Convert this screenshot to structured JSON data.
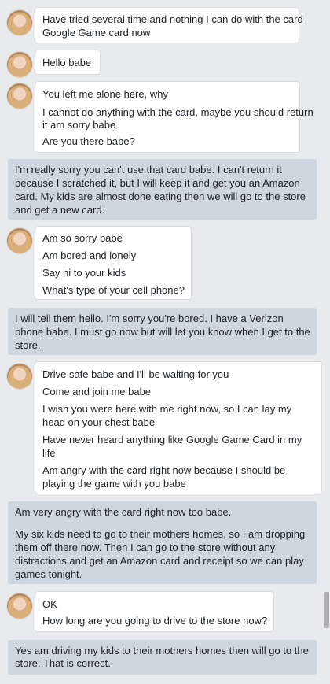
{
  "messages": [
    {
      "from": "them",
      "lines": [
        "Have tried several time and nothing I can do with the card",
        "Google Game card now"
      ]
    },
    {
      "from": "them",
      "lines": [
        "Hello babe"
      ]
    },
    {
      "from": "them",
      "lines": [
        "You left me alone here, why",
        "I cannot do anything with the card, maybe you should return",
        "it am sorry babe",
        "Are you there babe?"
      ]
    },
    {
      "from": "me",
      "lines": [
        "I'm really sorry you can't use that card babe. I can't return it",
        "because I scratched it, but I will keep it and get you an Amazon",
        "card. My kids are almost done eating then we will go to the store",
        "and get a new card."
      ]
    },
    {
      "from": "them",
      "lines": [
        "Am so sorry babe",
        "Am bored and lonely",
        "Say hi to your kids",
        "What's type of your cell phone?"
      ]
    },
    {
      "from": "me",
      "lines": [
        "I will tell them hello. I'm sorry you're bored. I have a Verizon",
        "phone babe. I must go now but will let you know when I get to the",
        "store."
      ]
    },
    {
      "from": "them",
      "lines": [
        "Drive safe babe and I'll be waiting for you",
        "Come and join me babe",
        "I wish you were here with me right now, so I can lay my",
        "head on your chest babe",
        "Have never heard anything like Google Game Card in my",
        "life",
        "Am angry with the card right now because I should be",
        "playing the game with you babe"
      ]
    },
    {
      "from": "me",
      "lines": [
        "Am very angry with the card right now too babe.",
        "My six kids need to go to their mothers homes, so I am dropping",
        "them off there now. Then I can go to the store without any",
        "distractions and get an Amazon card and receipt so we can play",
        "games tonight."
      ]
    },
    {
      "from": "them",
      "lines": [
        "OK",
        "How long are you going to drive to the store now?"
      ]
    },
    {
      "from": "me",
      "lines": [
        "Yes am driving my kids to their mothers homes then will go to the",
        "store. That is correct."
      ]
    }
  ]
}
